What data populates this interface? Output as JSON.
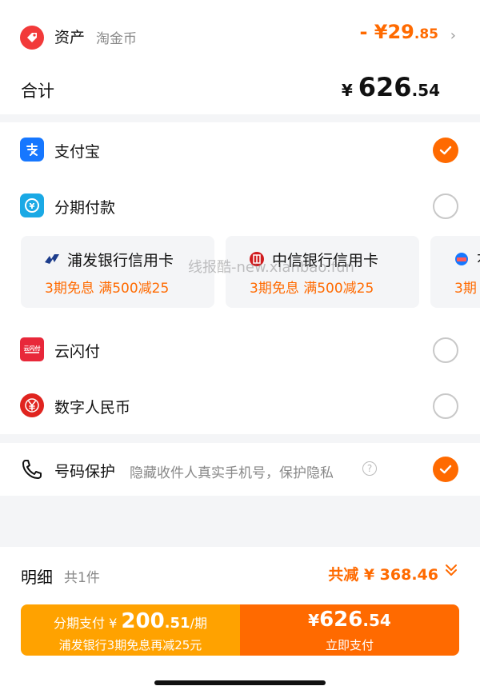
{
  "assets": {
    "label": "资产",
    "sub": "淘金币",
    "amount_prefix": "- ¥",
    "amount_int": "29",
    "amount_dec": ".85"
  },
  "total": {
    "label": "合计",
    "yen": "¥ ",
    "amount_int": "626",
    "amount_dec": ".54"
  },
  "payment": {
    "methods": [
      {
        "label": "支付宝",
        "icon": "alipay-icon",
        "selected": true
      },
      {
        "label": "分期付款",
        "icon": "installment-icon",
        "selected": false
      },
      {
        "label": "云闪付",
        "icon": "unionpay-icon",
        "selected": false
      },
      {
        "label": "数字人民币",
        "icon": "digital-rmb-icon",
        "selected": false
      }
    ],
    "bank_cards": [
      {
        "name": "浦发银行信用卡",
        "promo": "3期免息  满500减25",
        "icon": "spdb-logo-icon"
      },
      {
        "name": "中信银行信用卡",
        "promo": "3期免息  满500减25",
        "icon": "citic-logo-icon"
      },
      {
        "name": "花",
        "promo": "3期",
        "icon": "bank-logo-icon"
      }
    ]
  },
  "watermark": "线报酷-new.xianbao.fun",
  "privacy": {
    "label": "号码保护",
    "desc": "隐藏收件人真实手机号，保护隐私",
    "help": "?",
    "selected": true
  },
  "detail": {
    "label": "明细",
    "count": "共1件",
    "discount": "共减 ¥ 368.46"
  },
  "installment_button": {
    "prefix": "分期支付 ¥ ",
    "amount_int": "200",
    "amount_dec": ".51",
    "unit": "/期",
    "sub": "浦发银行3期免息再减25元"
  },
  "pay_button": {
    "yen": "¥",
    "amount_int": "626",
    "amount_dec": ".54",
    "label": "立即支付"
  },
  "colors": {
    "accent": "#ff6a00",
    "installment": "#ffa200",
    "alipay": "#1677ff"
  }
}
